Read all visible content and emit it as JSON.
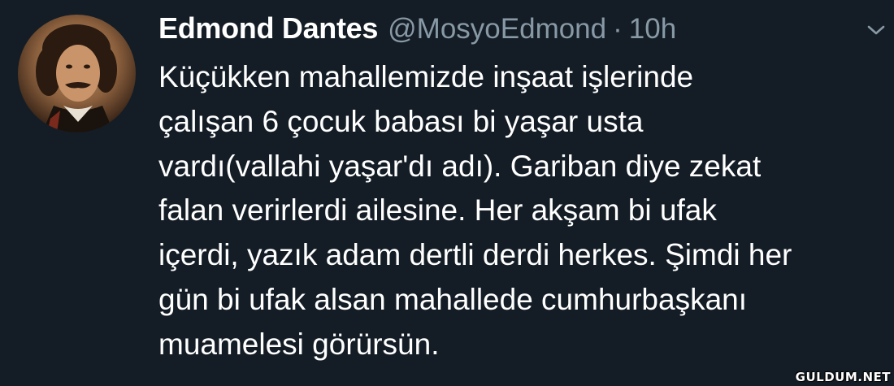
{
  "tweet": {
    "display_name": "Edmond Dantes",
    "handle": "@MosyoEdmond",
    "separator": "·",
    "time": "10h",
    "text_lines": [
      "Küçükken mahallemizde inşaat işlerinde",
      "çalışan 6 çocuk babası bi yaşar usta",
      "vardı(vallahi yaşar'dı adı). Gariban diye zekat",
      "falan verirlerdi ailesine. Her akşam bi ufak",
      "içerdi, yazık adam dertli derdi herkes. Şimdi her",
      "gün bi ufak alsan mahallede cumhurbaşkanı",
      "muamelesi görürsün."
    ]
  },
  "icons": {
    "menu": "chevron-down-icon",
    "avatar": "profile-avatar"
  },
  "colors": {
    "background": "#141d26",
    "text": "#ffffff",
    "secondary": "#8899a6"
  },
  "watermark": "GULDUM.NET"
}
